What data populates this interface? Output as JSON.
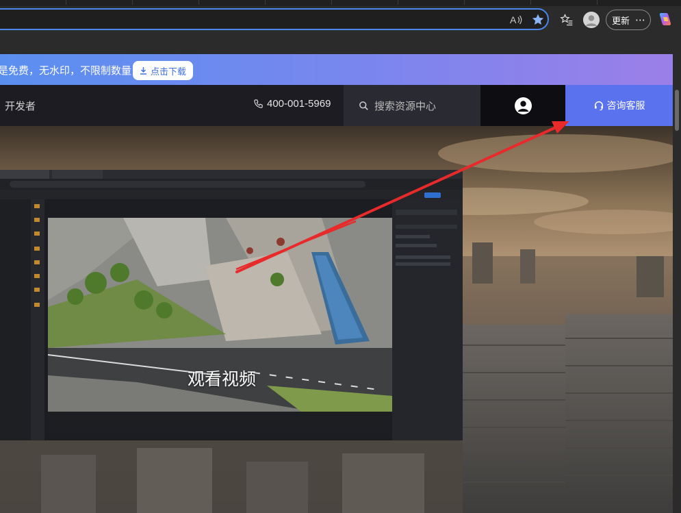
{
  "browser": {
    "toolbar": {
      "read_aloud_icon": "read-aloud-icon",
      "favorite_icon": "star-filled-icon",
      "favorites_icon": "favorites-list-icon",
      "profile_icon": "profile-avatar-icon",
      "update_label": "更新",
      "more_label": "⋯",
      "copilot_icon": "copilot-icon",
      "accent": "#4a87e8"
    }
  },
  "page": {
    "promo": {
      "text": "是免费，无水印，不限制数量",
      "download_label": "点击下载",
      "download_icon": "download-icon"
    },
    "nav": {
      "developer_label": "开发者",
      "phone": "400-001-5969",
      "phone_icon": "phone-icon",
      "search_placeholder": "搜索资源中心",
      "search_icon": "search-icon",
      "user_icon": "user-icon",
      "service_label": "咨询客服",
      "service_icon": "headset-icon",
      "service_color": "#5b72ee"
    },
    "hero": {
      "video_label": "观看视频"
    },
    "annotation": {
      "arrow_color": "#e82a2a"
    }
  }
}
